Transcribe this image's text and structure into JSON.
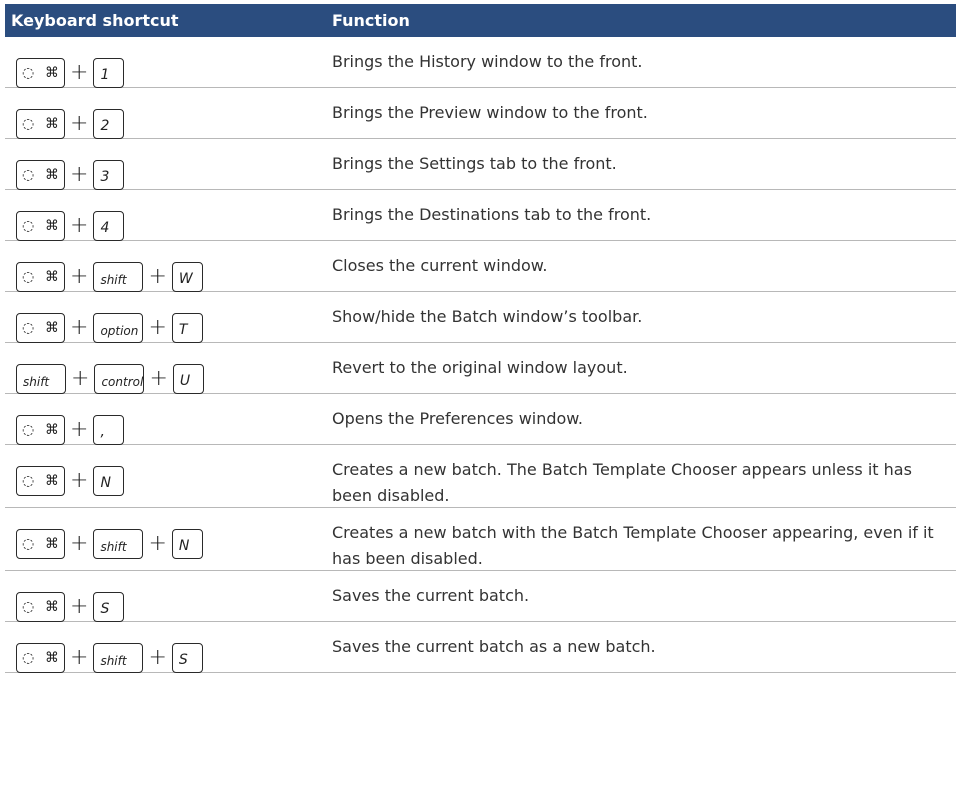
{
  "header": {
    "col1": "Keyboard shortcut",
    "col2": "Function"
  },
  "rows": [
    {
      "keys": [
        "cmd",
        "1"
      ],
      "desc": "Brings the History window to the front."
    },
    {
      "keys": [
        "cmd",
        "2"
      ],
      "desc": "Brings the Preview window to the front."
    },
    {
      "keys": [
        "cmd",
        "3"
      ],
      "desc": "Brings the Settings tab to the front."
    },
    {
      "keys": [
        "cmd",
        "4"
      ],
      "desc": "Brings the Destinations tab to the front."
    },
    {
      "keys": [
        "cmd",
        "shift",
        "W"
      ],
      "desc": "Closes the current window."
    },
    {
      "keys": [
        "cmd",
        "option",
        "T"
      ],
      "desc": "Show/hide the Batch window’s toolbar."
    },
    {
      "keys": [
        "shift",
        "control",
        "U"
      ],
      "desc": "Revert to the original window layout."
    },
    {
      "keys": [
        "cmd",
        ","
      ],
      "desc": "Opens the Preferences window."
    },
    {
      "keys": [
        "cmd",
        "N"
      ],
      "desc": "Creates a new batch. The Batch Template Chooser appears unless it has been disabled."
    },
    {
      "keys": [
        "cmd",
        "shift",
        "N"
      ],
      "desc": "Creates a new batch with the Batch Template Chooser appearing, even if it has been disabled."
    },
    {
      "keys": [
        "cmd",
        "S"
      ],
      "desc": "Saves the current batch."
    },
    {
      "keys": [
        "cmd",
        "shift",
        "S"
      ],
      "desc": "Saves the current batch as a new batch."
    }
  ],
  "symbols": {
    "apple": "",
    "command": "⌘",
    "plus": "+"
  },
  "colors": {
    "header_bg": "#2b4d7f",
    "header_text": "#ffffff",
    "rule": "#b8b8b8"
  }
}
